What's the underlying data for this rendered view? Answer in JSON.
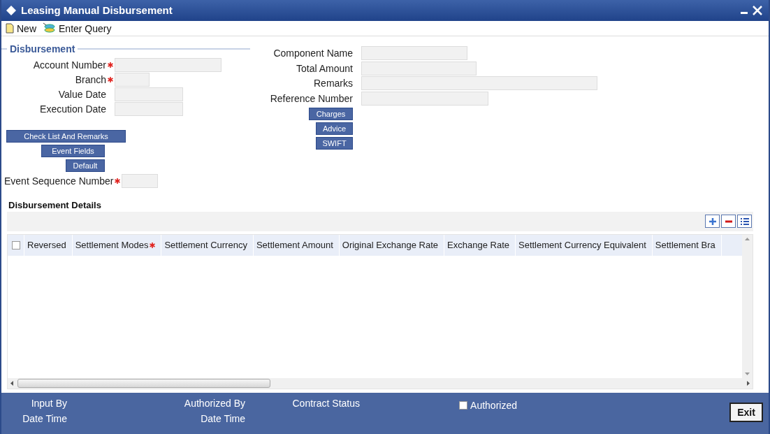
{
  "window": {
    "title": "Leasing Manual Disbursement"
  },
  "toolbar": [
    "New",
    "Enter Query"
  ],
  "disbursement": {
    "legend": "Disbursement",
    "fields": [
      {
        "label": "Account Number",
        "required": true
      },
      {
        "label": "Branch",
        "required": true
      },
      {
        "label": "Value Date",
        "required": false
      },
      {
        "label": "Execution Date",
        "required": false
      }
    ],
    "buttons": [
      "Check List And Remarks",
      "Event Fields",
      "Default"
    ],
    "sequence": {
      "label": "Event Sequence Number",
      "required": true
    }
  },
  "right_fields": [
    {
      "label": "Component Name"
    },
    {
      "label": "Total Amount"
    },
    {
      "label": "Remarks"
    },
    {
      "label": "Reference Number"
    }
  ],
  "right_buttons": [
    "Charges",
    "Advice",
    "SWIFT"
  ],
  "details": {
    "title": "Disbursement Details",
    "select_all": {
      "checked": false
    },
    "columns": [
      {
        "label": "Reversed",
        "required": false
      },
      {
        "label": "Settlement Modes",
        "required": true
      },
      {
        "label": "Settlement Currency",
        "required": false
      },
      {
        "label": "Settlement Amount",
        "required": false
      },
      {
        "label": "Original Exchange Rate",
        "required": false
      },
      {
        "label": "Exchange Rate",
        "required": false
      },
      {
        "label": "Settlement Currency Equivalent",
        "required": false
      },
      {
        "label": "Settlement Bra",
        "required": false
      }
    ]
  },
  "footer": {
    "input_by": "Input By",
    "input_date": "Date Time",
    "authorized_by": "Authorized By",
    "authorized_date": "Date Time",
    "contract_status": "Contract Status",
    "authorized": {
      "label": "Authorized",
      "checked": false
    },
    "exit": "Exit"
  }
}
